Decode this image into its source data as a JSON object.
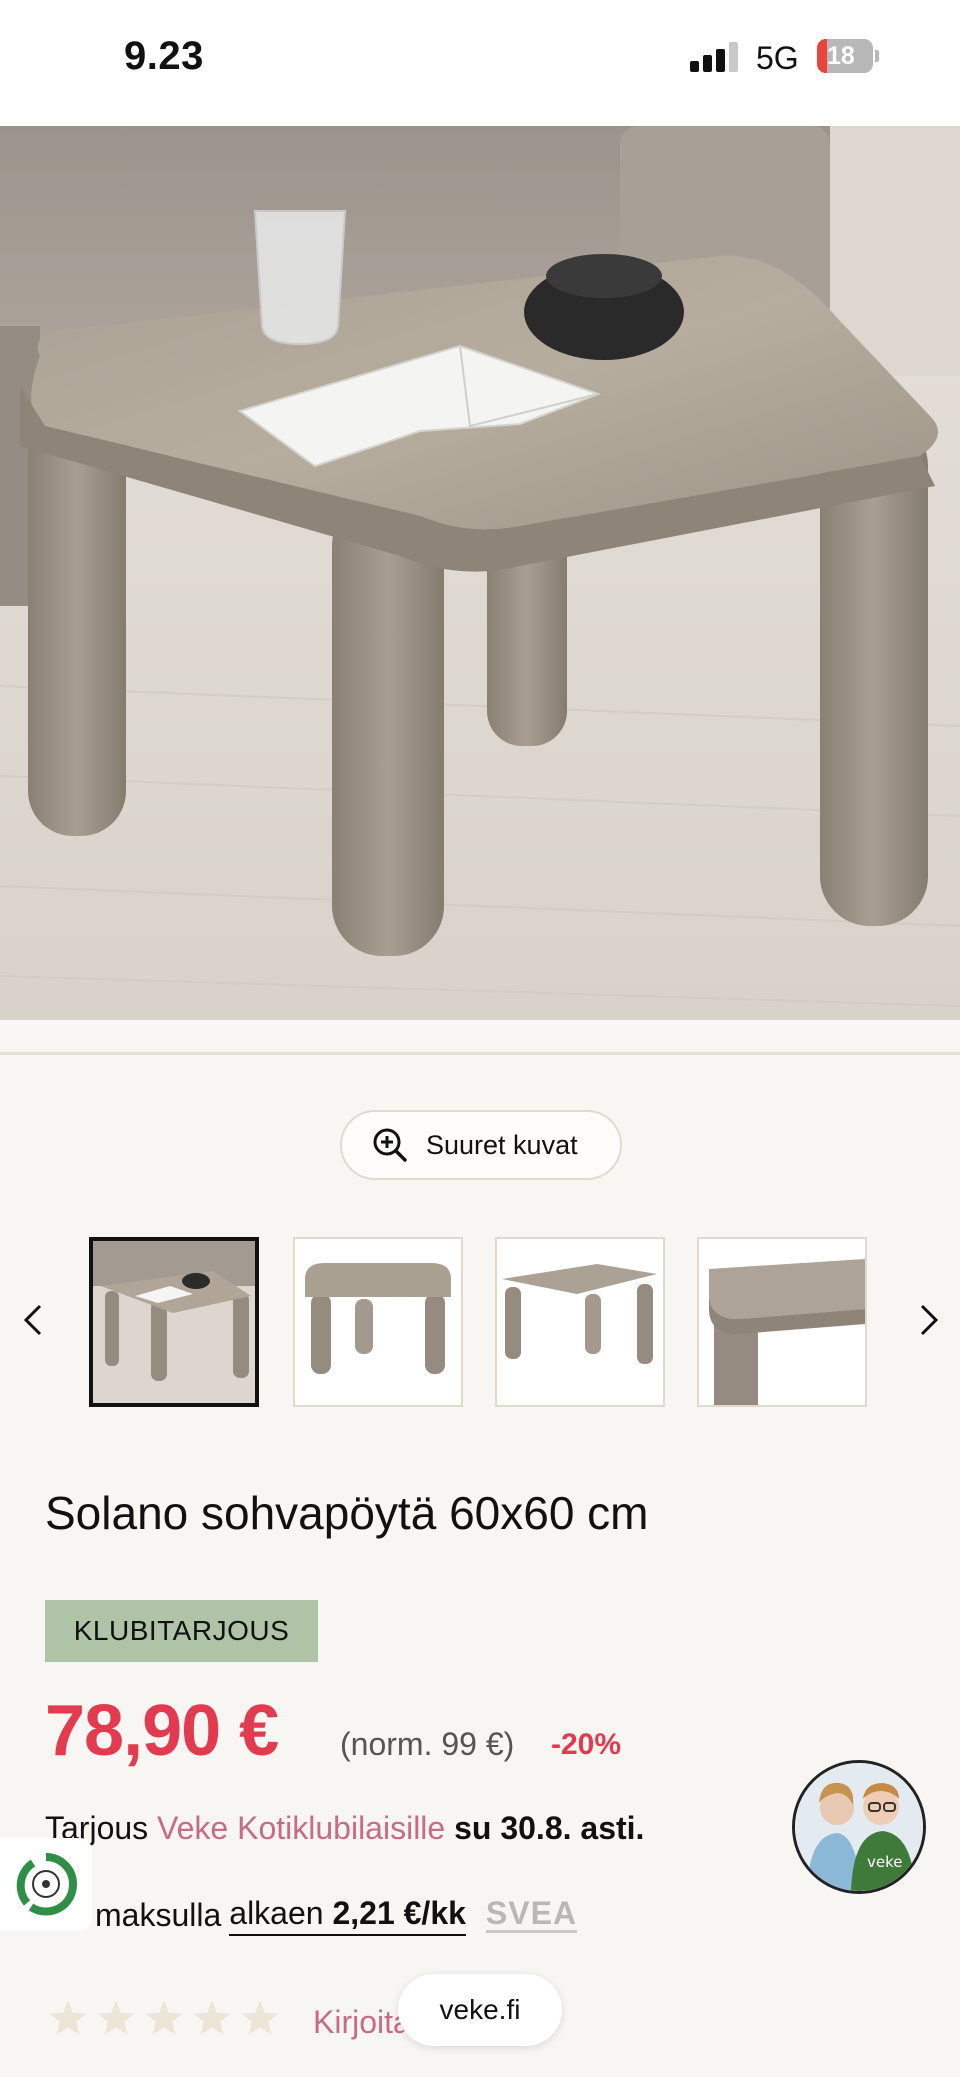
{
  "status_bar": {
    "time": "9.23",
    "network": "5G",
    "battery": "18",
    "battery_level_percent": 18
  },
  "gallery": {
    "zoom_label": "Suuret kuvat",
    "thumbnail_count": 4,
    "active_thumbnail": 1
  },
  "product": {
    "title": "Solano sohvapöytä 60x60 cm",
    "badge": "KLUBITARJOUS",
    "price": "78,90 €",
    "normal_price": "(norm. 99 €)",
    "discount": "-20%",
    "offer_prefix": "Tarjous ",
    "offer_link": "Veke Kotiklubilaisille",
    "offer_suffix": " su 30.8. asti.",
    "installment_prefix": "maksulla",
    "installment_from": "alkaen",
    "installment_amount": "2,21 €/kk",
    "installment_provider": "SVEA",
    "review_link": "Kirjoita arvostelu"
  },
  "browser": {
    "url": "veke.fi"
  },
  "colors": {
    "price_red": "#e23a4f",
    "link_pink": "#c86b87",
    "badge_green": "#afc4a6",
    "star_beige": "#ece6d6"
  },
  "icons": [
    "zoom-in-icon",
    "chevron-left-icon",
    "chevron-right-icon",
    "star-icon",
    "cellular-signal-icon",
    "battery-icon",
    "eco-recycle-icon",
    "chat-support-avatar"
  ]
}
